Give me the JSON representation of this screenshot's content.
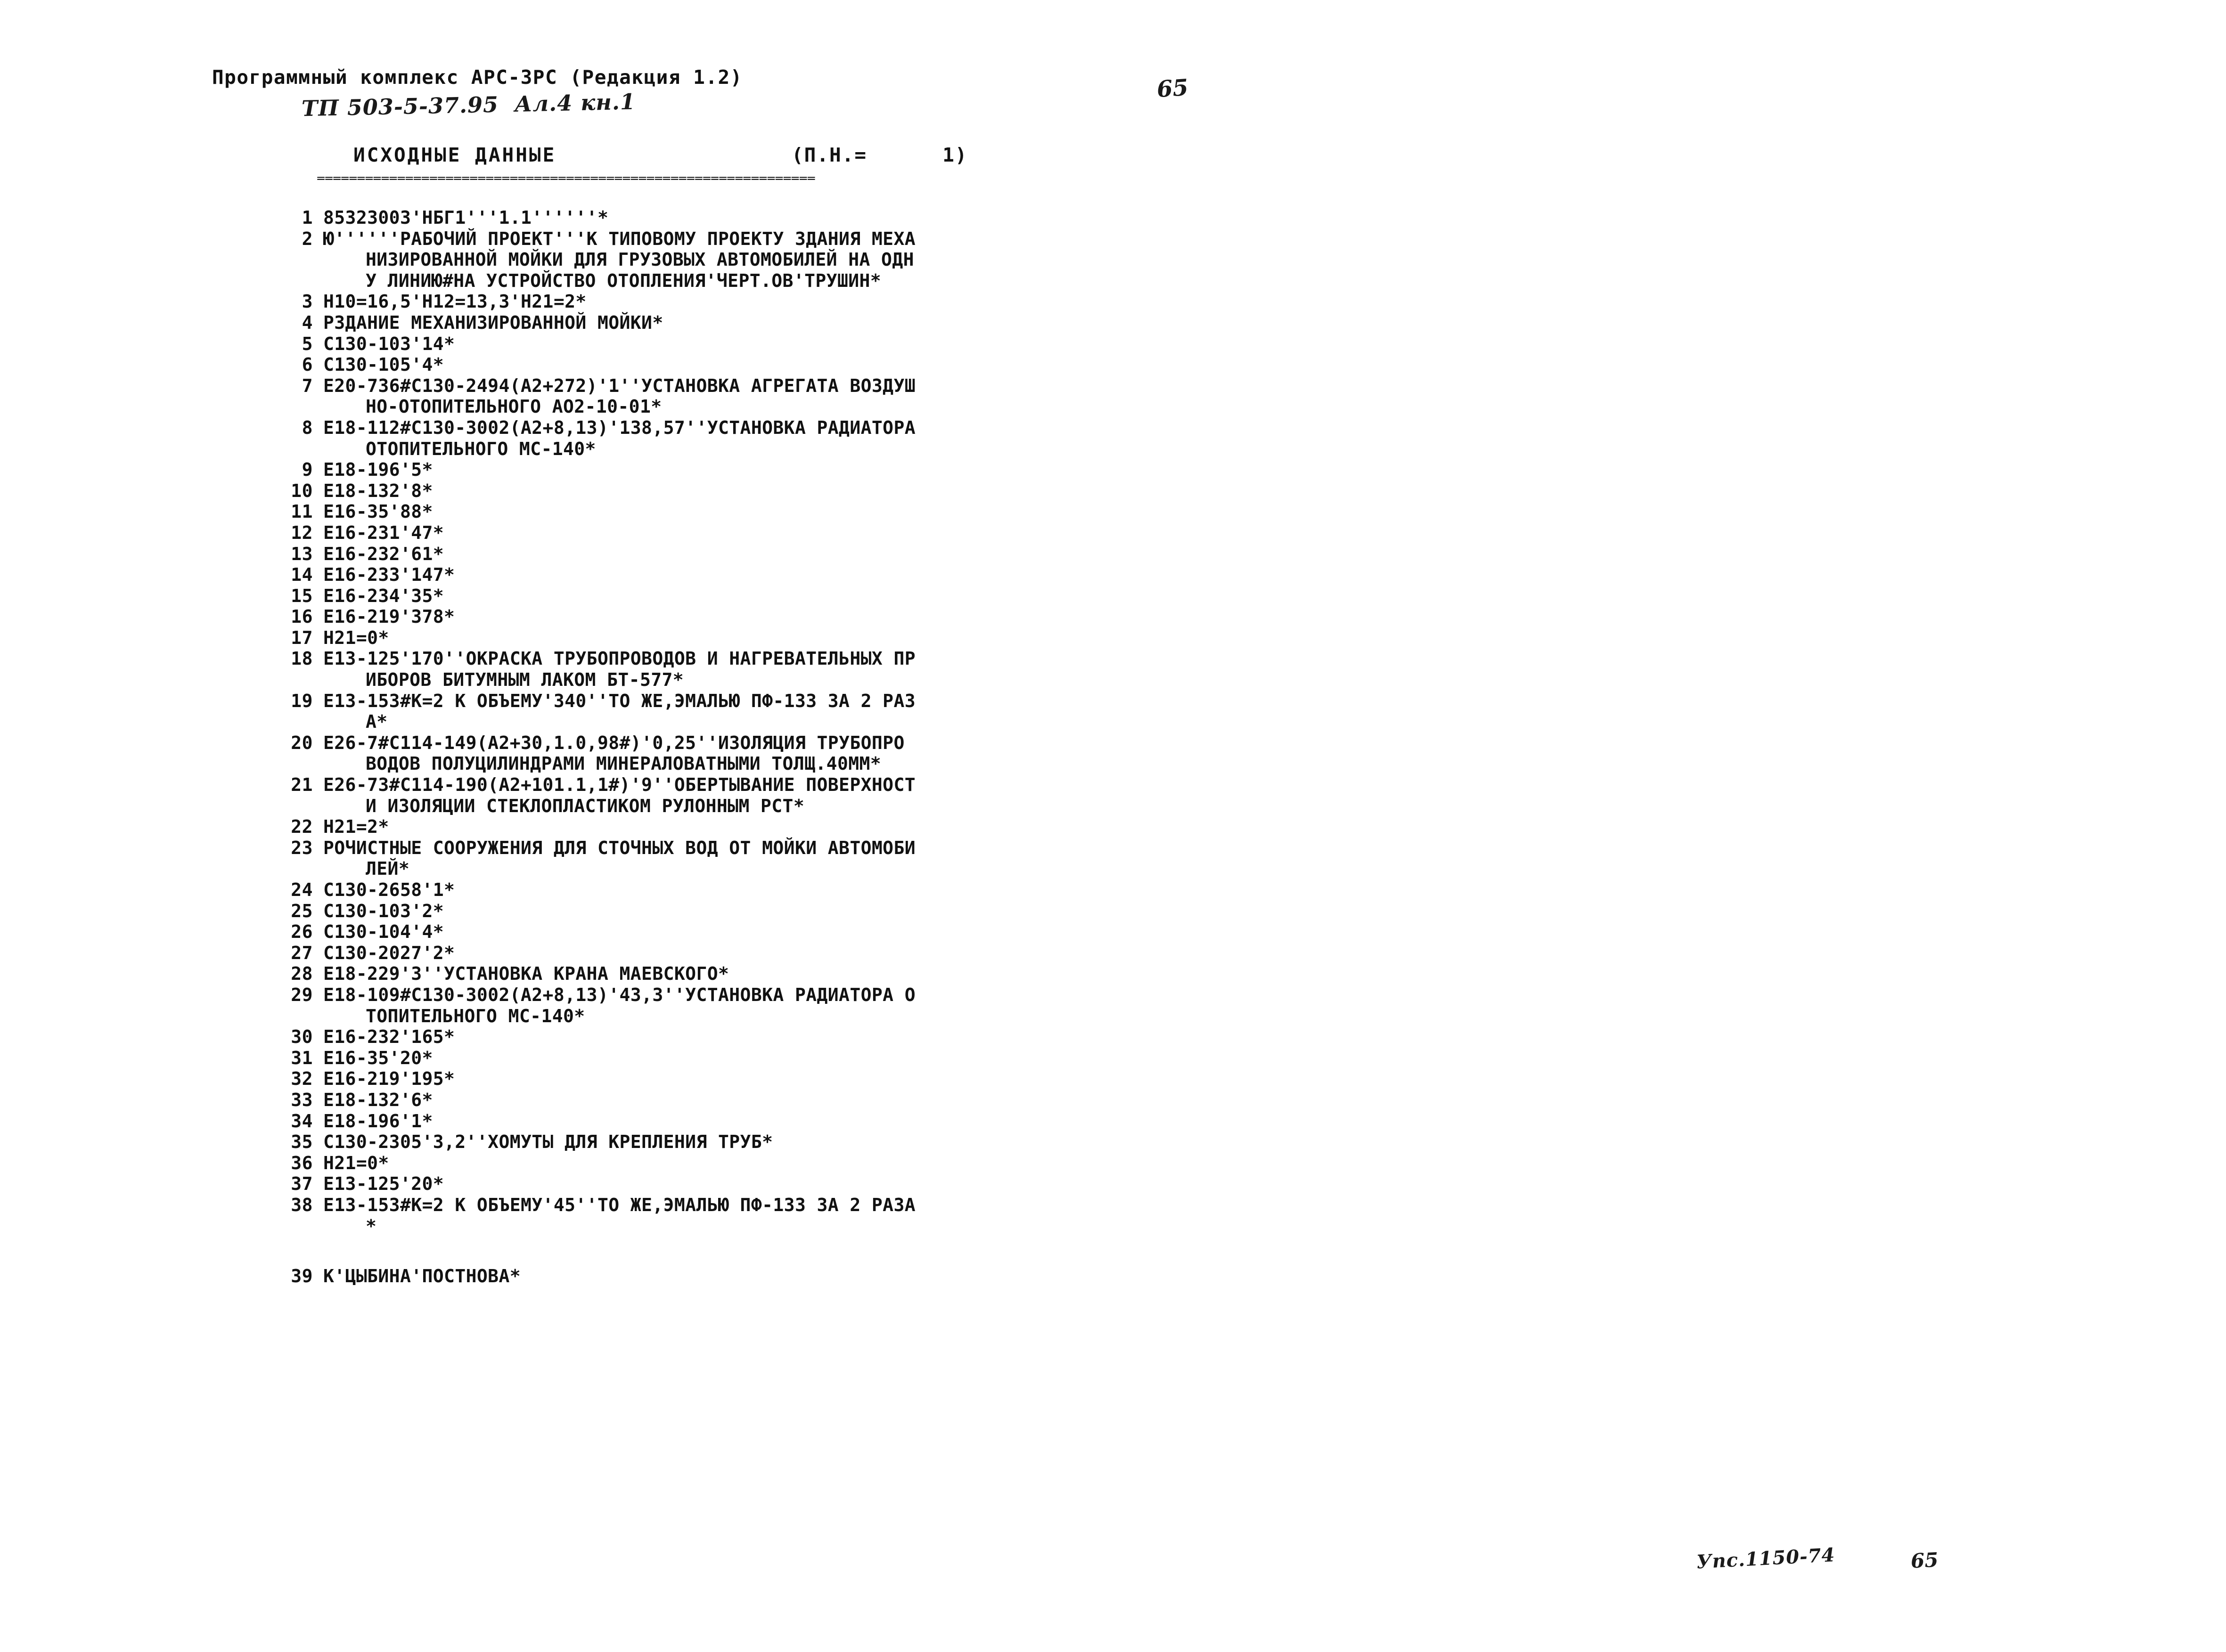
{
  "document": {
    "program_header": "Программный комплекс АРС-ЗРС (Редакция 1.2)",
    "handwritten_code": "ТП 503-5-37.95  Ал.4 кн.1",
    "handwritten_page_number": "65",
    "section_title": "ИСХОДНЫЕ ДАННЫЕ",
    "pn_label": "(П.Н.=      1)",
    "separator": "==============================================================",
    "handwritten_footer": "Упс.1150-74",
    "handwritten_footer_number": "65"
  },
  "listing": [
    {
      "num": "1",
      "text": "85323003'НБГ1'''1.1''''''*",
      "continuations": []
    },
    {
      "num": "2",
      "text": "Ю''''''РАБОЧИЙ ПРОЕКТ'''К ТИПОВОМУ ПРОЕКТУ ЗДАНИЯ МЕХА",
      "continuations": [
        "НИЗИРОВАННОЙ МОЙКИ ДЛЯ ГРУЗОВЫХ АВТОМОБИЛЕЙ НА ОДН",
        "У ЛИНИЮ#НА УСТРОЙСТВО ОТОПЛЕНИЯ'ЧЕРТ.ОВ'ТРУШИН*"
      ]
    },
    {
      "num": "3",
      "text": "Н10=16,5'Н12=13,3'Н21=2*",
      "continuations": []
    },
    {
      "num": "4",
      "text": "РЗДАНИЕ МЕХАНИЗИРОВАННОЙ МОЙКИ*",
      "continuations": []
    },
    {
      "num": "5",
      "text": "С130-103'14*",
      "continuations": []
    },
    {
      "num": "6",
      "text": "С130-105'4*",
      "continuations": []
    },
    {
      "num": "7",
      "text": "Е20-736#С130-2494(А2+272)'1''УСТАНОВКА АГРЕГАТА ВОЗДУШ",
      "continuations": [
        "НО-ОТОПИТЕЛЬНОГО АО2-10-01*"
      ]
    },
    {
      "num": "8",
      "text": "Е18-112#С130-3002(А2+8,13)'138,57''УСТАНОВКА РАДИАТОРА",
      "continuations": [
        "ОТОПИТЕЛЬНОГО МС-140*"
      ]
    },
    {
      "num": "9",
      "text": "Е18-196'5*",
      "continuations": []
    },
    {
      "num": "10",
      "text": "Е18-132'8*",
      "continuations": []
    },
    {
      "num": "11",
      "text": "Е16-35'88*",
      "continuations": []
    },
    {
      "num": "12",
      "text": "Е16-231'47*",
      "continuations": []
    },
    {
      "num": "13",
      "text": "Е16-232'61*",
      "continuations": []
    },
    {
      "num": "14",
      "text": "Е16-233'147*",
      "continuations": []
    },
    {
      "num": "15",
      "text": "Е16-234'35*",
      "continuations": []
    },
    {
      "num": "16",
      "text": "Е16-219'378*",
      "continuations": []
    },
    {
      "num": "17",
      "text": "Н21=0*",
      "continuations": []
    },
    {
      "num": "18",
      "text": "Е13-125'170''ОКРАСКА ТРУБОПРОВОДОВ И НАГРЕВАТЕЛЬНЫХ ПР",
      "continuations": [
        "ИБОРОВ БИТУМНЫМ ЛАКОМ БТ-577*"
      ]
    },
    {
      "num": "19",
      "text": "Е13-153#К=2 К ОБЪЕМУ'340''ТО ЖЕ,ЭМАЛЬЮ ПФ-133 ЗА 2 РАЗ",
      "continuations": [
        "А*"
      ]
    },
    {
      "num": "20",
      "text": "Е26-7#С114-149(А2+30,1.0,98#)'0,25''ИЗОЛЯЦИЯ ТРУБОПРО",
      "continuations": [
        "ВОДОВ ПОЛУЦИЛИНДРАМИ МИНЕРАЛОВАТНЫМИ ТОЛЩ.40ММ*"
      ]
    },
    {
      "num": "21",
      "text": "Е26-73#С114-190(А2+101.1,1#)'9''ОБЕРТЫВАНИЕ ПОВЕРХНОСТ",
      "continuations": [
        "И ИЗОЛЯЦИИ СТЕКЛОПЛАСТИКОМ РУЛОННЫМ РСТ*"
      ]
    },
    {
      "num": "22",
      "text": "Н21=2*",
      "continuations": []
    },
    {
      "num": "23",
      "text": "РОЧИСТНЫЕ СООРУЖЕНИЯ ДЛЯ СТОЧНЫХ ВОД ОТ МОЙКИ АВТОМОБИ",
      "continuations": [
        "ЛЕЙ*"
      ]
    },
    {
      "num": "24",
      "text": "С130-2658'1*",
      "continuations": []
    },
    {
      "num": "25",
      "text": "С130-103'2*",
      "continuations": []
    },
    {
      "num": "26",
      "text": "С130-104'4*",
      "continuations": []
    },
    {
      "num": "27",
      "text": "С130-2027'2*",
      "continuations": []
    },
    {
      "num": "28",
      "text": "Е18-229'3''УСТАНОВКА КРАНА МАЕВСКОГО*",
      "continuations": []
    },
    {
      "num": "29",
      "text": "Е18-109#С130-3002(А2+8,13)'43,3''УСТАНОВКА РАДИАТОРА О",
      "continuations": [
        "ТОПИТЕЛЬНОГО МС-140*"
      ]
    },
    {
      "num": "30",
      "text": "Е16-232'165*",
      "continuations": []
    },
    {
      "num": "31",
      "text": "Е16-35'20*",
      "continuations": []
    },
    {
      "num": "32",
      "text": "Е16-219'195*",
      "continuations": []
    },
    {
      "num": "33",
      "text": "Е18-132'6*",
      "continuations": []
    },
    {
      "num": "34",
      "text": "Е18-196'1*",
      "continuations": []
    },
    {
      "num": "35",
      "text": "С130-2305'3,2''ХОМУТЫ ДЛЯ КРЕПЛЕНИЯ ТРУБ*",
      "continuations": []
    },
    {
      "num": "36",
      "text": "Н21=0*",
      "continuations": []
    },
    {
      "num": "37",
      "text": "Е13-125'20*",
      "continuations": []
    },
    {
      "num": "38",
      "text": "Е13-153#К=2 К ОБЪЕМУ'45''ТО ЖЕ,ЭМАЛЬЮ ПФ-133 ЗА 2 РАЗА",
      "continuations": [
        "*"
      ]
    },
    {
      "num": "39",
      "text": "К'ЦЫБИНА'ПОСТНОВА*",
      "continuations": [],
      "gap_before": true
    }
  ]
}
